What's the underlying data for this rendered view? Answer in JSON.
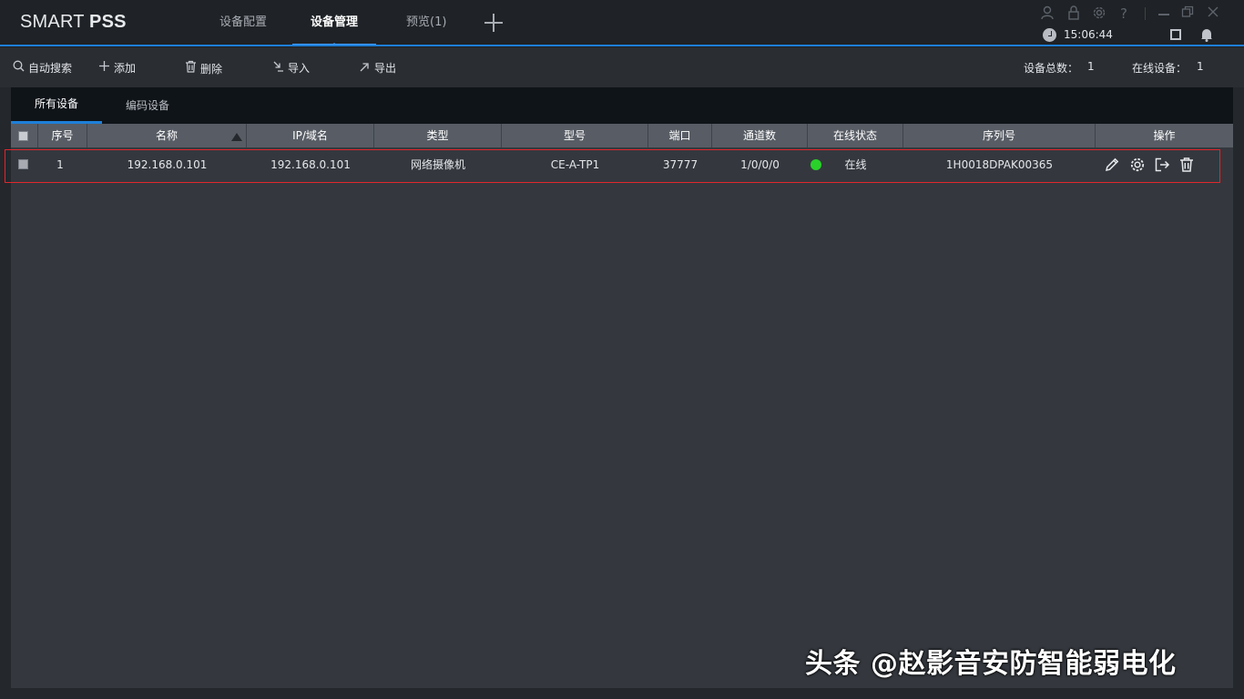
{
  "app": {
    "logo_prefix": "SMART ",
    "logo_bold": "PSS"
  },
  "nav": {
    "tabs": [
      {
        "label": "设备配置"
      },
      {
        "label": "设备管理"
      },
      {
        "label": "预览(1)"
      }
    ],
    "active_tab": "设备管理"
  },
  "status": {
    "time": "15:06:44"
  },
  "toolbar": {
    "auto_search": "自动搜索",
    "add": "添加",
    "delete": "删除",
    "import": "导入",
    "export": "导出",
    "total_label": "设备总数：",
    "total_value": "1",
    "online_label": "在线设备：",
    "online_value": "1"
  },
  "subtabs": [
    {
      "label": "所有设备"
    },
    {
      "label": "编码设备"
    }
  ],
  "table": {
    "headers": [
      "序号",
      "名称",
      "IP/域名",
      "类型",
      "型号",
      "端口",
      "通道数",
      "在线状态",
      "序列号",
      "操作"
    ],
    "rows": [
      {
        "index": "1",
        "name": "192.168.0.101",
        "ip": "192.168.0.101",
        "type": "网络摄像机",
        "model": "CE-A-TP1",
        "port": "37777",
        "channels": "1/0/0/0",
        "status": "在线",
        "serial": "1H0018DPAK00365"
      }
    ],
    "operations": [
      "edit-icon",
      "settings-icon",
      "export-icon",
      "delete-icon"
    ]
  },
  "colors": {
    "accent": "#1e7fd8",
    "online": "#2ad12a",
    "highlight": "#e0262c"
  },
  "watermark": "头条 @赵影音安防智能弱电化"
}
